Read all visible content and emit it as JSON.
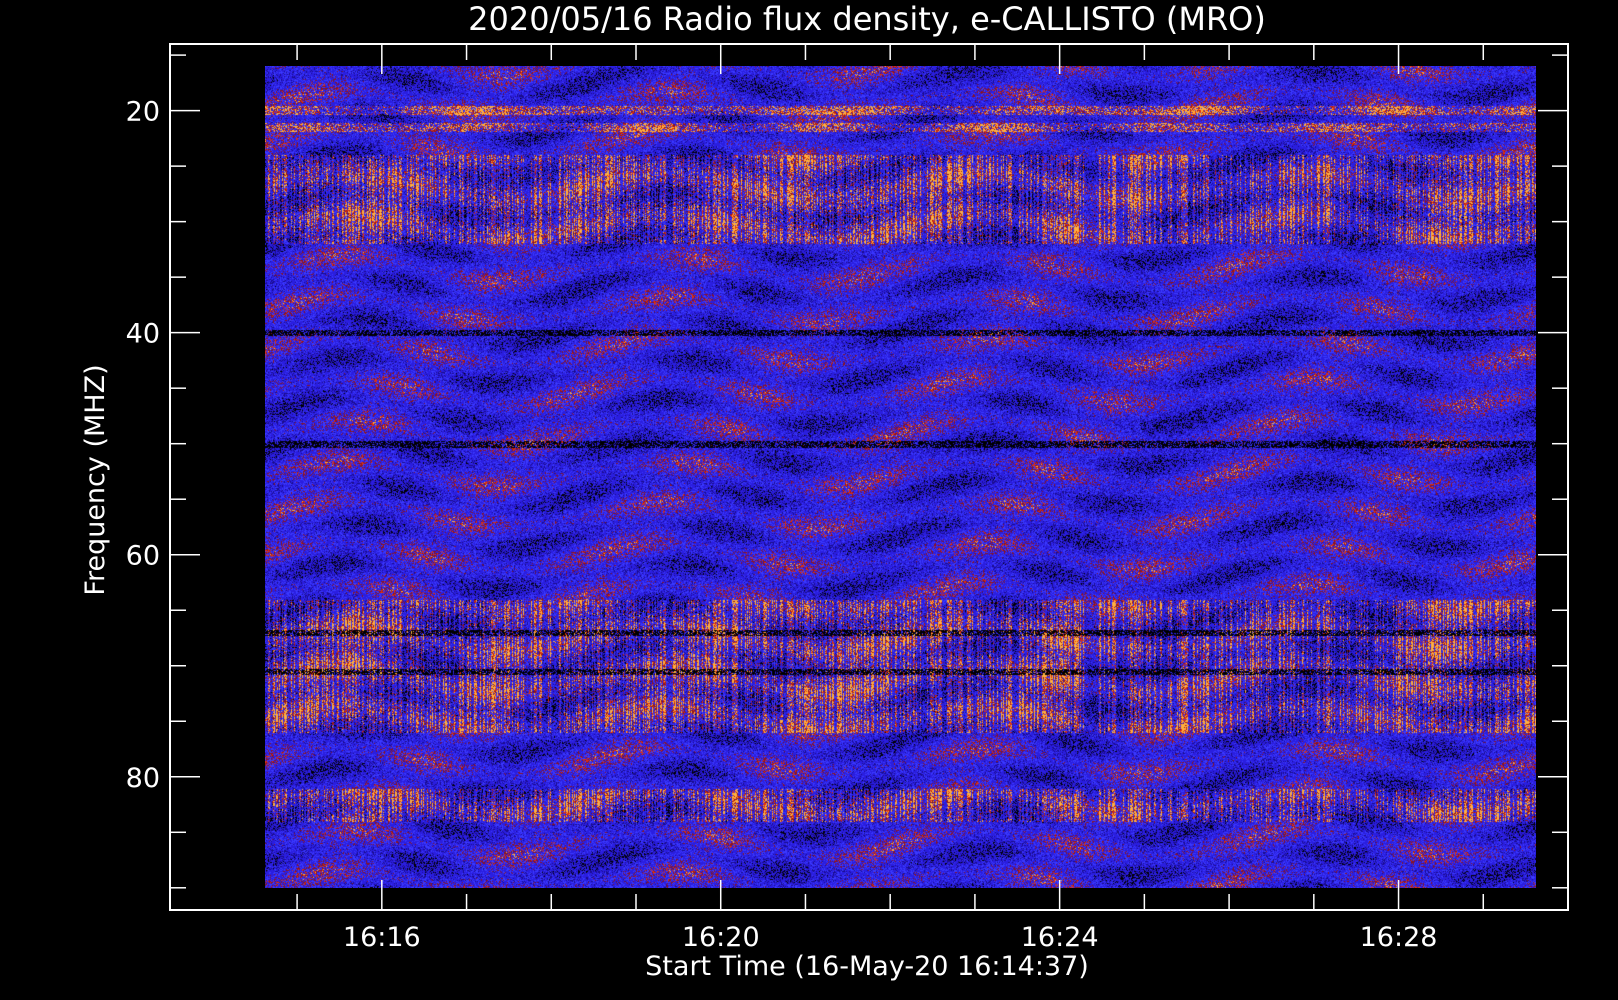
{
  "chart_data": {
    "type": "heatmap",
    "title": "2020/05/16  Radio flux density, e-CALLISTO (MRO)",
    "xlabel": "Start Time (16-May-20 16:14:37)",
    "ylabel": "Frequency (MHZ)",
    "x_tick_labels": [
      "16:16",
      "16:20",
      "16:24",
      "16:28"
    ],
    "x_ticks_minutes": [
      16,
      20,
      24,
      28
    ],
    "x_minor_ticks_minutes": [
      15,
      16,
      17,
      18,
      19,
      20,
      21,
      22,
      23,
      24,
      25,
      26,
      27,
      28,
      29,
      30
    ],
    "x_range_minutes": [
      13.5,
      30.0
    ],
    "data_x_range_minutes": [
      14.62,
      29.62
    ],
    "y_tick_labels": [
      "20",
      "40",
      "60",
      "80"
    ],
    "y_ticks": [
      20,
      40,
      60,
      80
    ],
    "y_minor_ticks": [
      15,
      20,
      25,
      30,
      35,
      40,
      45,
      50,
      55,
      60,
      65,
      70,
      75,
      80,
      85,
      90
    ],
    "ylim": [
      14,
      92
    ],
    "data_y_range": [
      16,
      90
    ],
    "y_inverted": true,
    "colormap": [
      "#000000",
      "#1a0c8c",
      "#2a1ee0",
      "#3a3aff",
      "#8a1420",
      "#e0300c",
      "#ffb040"
    ],
    "bright_bands_mhz": [
      20,
      21.5
    ],
    "active_bands_mhz": [
      [
        24,
        32
      ],
      [
        64,
        76
      ],
      [
        81,
        84
      ]
    ],
    "dark_lines_mhz": [
      40,
      50,
      67,
      70.5
    ]
  }
}
